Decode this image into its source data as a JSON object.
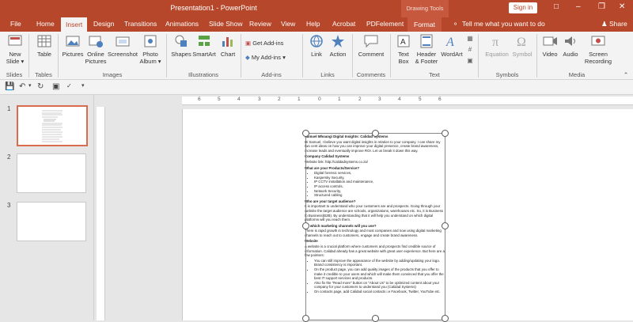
{
  "window": {
    "title": "Presentation1  -  PowerPoint",
    "context_label": "Drawing Tools",
    "sign_in": "Sign in"
  },
  "tabs": [
    "File",
    "Home",
    "Insert",
    "Design",
    "Transitions",
    "Animations",
    "Slide Show",
    "Review",
    "View",
    "Help",
    "Acrobat",
    "PDFelement",
    "Format"
  ],
  "active_tab": "Insert",
  "tell_me": "Tell me what you want to do",
  "share": "Share",
  "ribbon": {
    "new_slide": [
      "New",
      "Slide"
    ],
    "table": "Table",
    "pictures": "Pictures",
    "online_pictures": [
      "Online",
      "Pictures"
    ],
    "screenshot": "Screenshot",
    "photo_album": [
      "Photo",
      "Album"
    ],
    "shapes": "Shapes",
    "smartart": "SmartArt",
    "chart": "Chart",
    "get_addins": "Get Add-ins",
    "my_addins": "My Add-ins",
    "link": "Link",
    "action": "Action",
    "comment": "Comment",
    "text_box": [
      "Text",
      "Box"
    ],
    "header_footer": [
      "Header",
      "& Footer"
    ],
    "wordart": "WordArt",
    "equation": "Equation",
    "symbol": "Symbol",
    "video": "Video",
    "audio": "Audio",
    "screen_recording": [
      "Screen",
      "Recording"
    ],
    "groups": [
      "Slides",
      "Tables",
      "Images",
      "Illustrations",
      "Add-ins",
      "Links",
      "Comments",
      "Text",
      "Symbols",
      "Media"
    ]
  },
  "slides": {
    "numbers": [
      "1",
      "2",
      "3"
    ],
    "selected": 1
  },
  "ruler_marks": [
    "6",
    "5",
    "4",
    "3",
    "2",
    "1",
    "0",
    "1",
    "2",
    "3",
    "4",
    "5",
    "6"
  ],
  "doc": {
    "title": "Samuel Mhoangi Digital Insights: Calidad Systems",
    "intro": "Hi Samuel, I believe you want digital insights in relation to your company. I can share my two cent ideas on how you can improve your digital presence, create brand awareness, increase leads and eventually improve ROI. Let us break it down this way.",
    "company_h": "Company Calidad Systems",
    "website_link": "Website link: http://calidadsystems.co.za/",
    "products_h": "What are your Products/Service?",
    "products": [
      "Digital forensic services,",
      "Kaspersky Security,",
      "IP CCTV installation and maintenance,",
      "IP access controls,",
      "Network Security,",
      "Structured cabling"
    ],
    "audience_h": "Who are your target audience?",
    "audience": "It is important to understand who your customers are and prospects. Going through your website the target audience are schools, organizations, warehouses etc. So, it is Business to Business(B2B). By understanding that it will help you understand on which digital platforms will you reach them.",
    "channels_h": "So which marketing channels will you use?",
    "channels": "There is rapid growth in technology and most companies and now using digital marketing channels to reach out to customers, engage and create brand awareness.",
    "website_h": "Website",
    "website": "A website is a crucial platform where customers and prospects find credible source of information. Calidad already has a great website with great user experience. But here are a few pointers:",
    "pointers": [
      "You can still improve the appearance of the website by adding/updating your logo. Brand consistency is important.",
      "On the product page, you can add quality images of the products that you offer to make it credible to your users and which will make them convinced that you offer the best IT support services and products.",
      "Also fix the \"Read more\" button on \"About Us\" to be optimized content about your company for your customers to understand you (Calidad Systems)",
      "On contacts page, add Calidad social contacts i.e Facebook, Twitter, YouTube etc."
    ]
  }
}
